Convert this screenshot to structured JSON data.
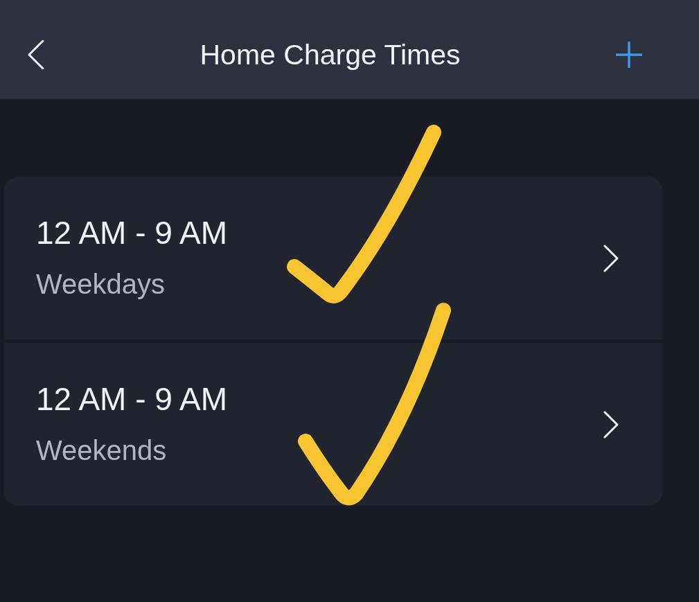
{
  "header": {
    "title": "Home Charge Times"
  },
  "schedules": [
    {
      "time_range": "12 AM - 9 AM",
      "days": "Weekdays",
      "ticked": true
    },
    {
      "time_range": "12 AM - 9 AM",
      "days": "Weekends",
      "ticked": true
    }
  ]
}
